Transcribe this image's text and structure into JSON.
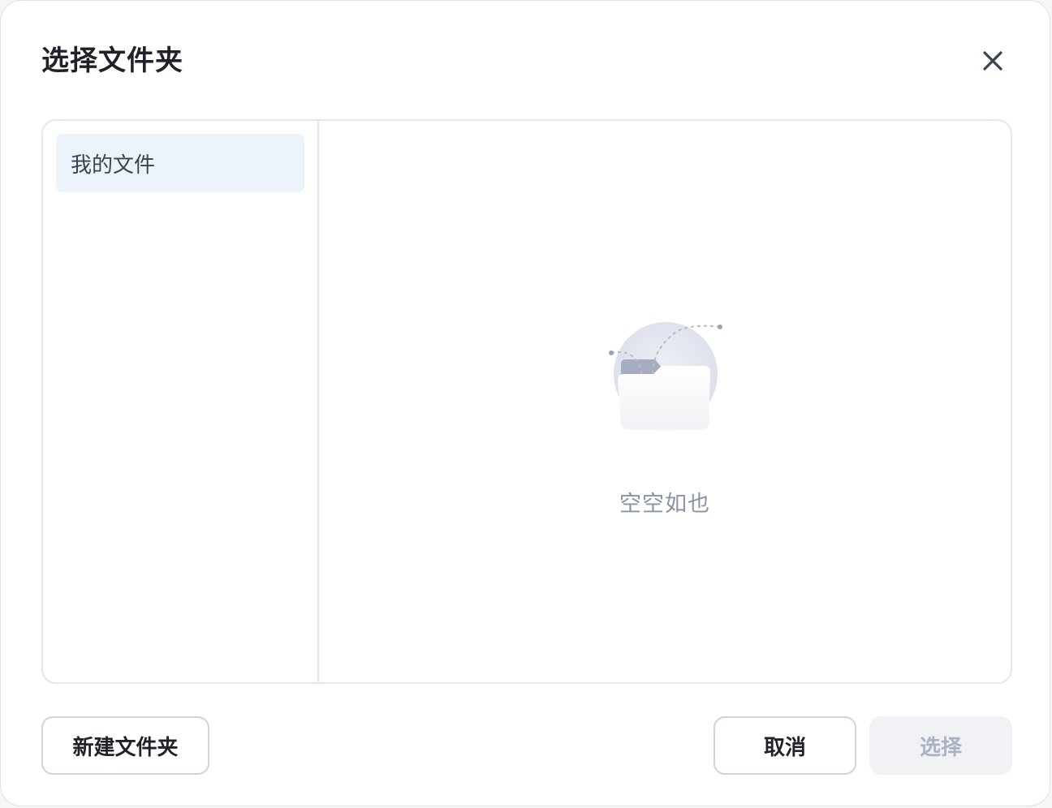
{
  "dialog": {
    "title": "选择文件夹",
    "close_icon": "close-icon"
  },
  "sidebar": {
    "items": [
      {
        "label": "我的文件",
        "selected": true
      }
    ]
  },
  "main": {
    "empty_icon": "empty-folder-illustration",
    "empty_text": "空空如也"
  },
  "footer": {
    "new_folder_label": "新建文件夹",
    "cancel_label": "取消",
    "select_label": "选择",
    "select_disabled": true
  },
  "colors": {
    "selected_bg": "#edf3fb",
    "disabled_bg": "#f0f2f6",
    "disabled_text": "#a9b3c4",
    "border": "#e4e7ec"
  }
}
